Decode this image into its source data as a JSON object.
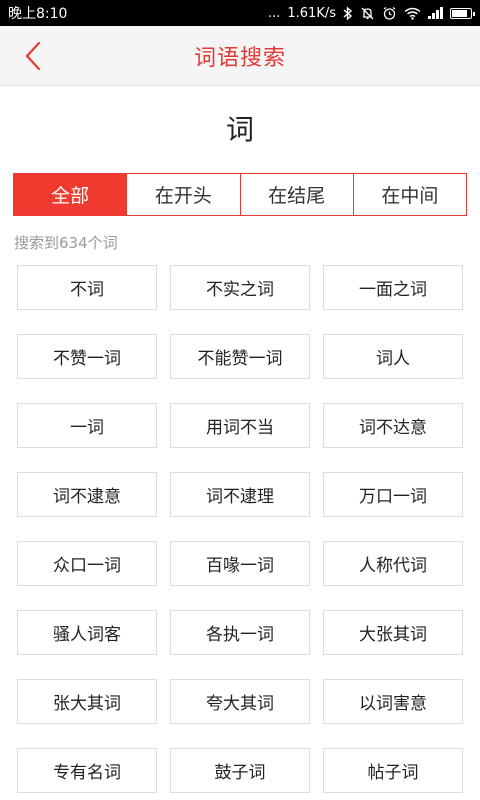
{
  "status_bar": {
    "time": "晚上8:10",
    "dots": "...",
    "speed": "1.61K/s",
    "icons": [
      "bluetooth-icon",
      "mute-icon",
      "alarm-icon",
      "wifi-icon",
      "signal-icon",
      "battery-icon"
    ],
    "battery_level": 0.9
  },
  "header": {
    "title": "词语搜索",
    "accent_color": "#e53935"
  },
  "query": "词",
  "tabs": [
    {
      "label": "全部",
      "active": true
    },
    {
      "label": "在开头",
      "active": false
    },
    {
      "label": "在结尾",
      "active": false
    },
    {
      "label": "在中间",
      "active": false
    }
  ],
  "result_count": "搜索到634个词",
  "words": [
    "不词",
    "不实之词",
    "一面之词",
    "不赞一词",
    "不能赞一词",
    "词人",
    "一词",
    "用词不当",
    "词不达意",
    "词不逮意",
    "词不逮理",
    "万口一词",
    "众口一词",
    "百喙一词",
    "人称代词",
    "骚人词客",
    "各执一词",
    "大张其词",
    "张大其词",
    "夸大其词",
    "以词害意",
    "专有名词",
    "鼓子词",
    "帖子词"
  ]
}
